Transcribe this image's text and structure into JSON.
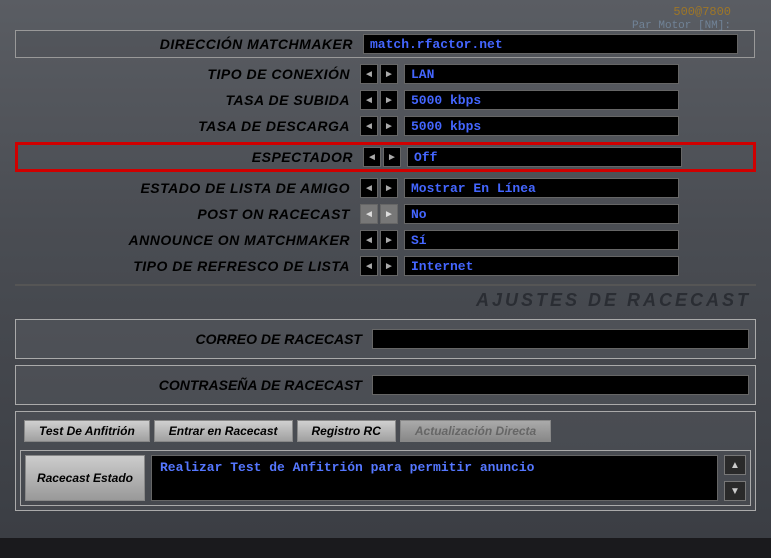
{
  "top": {
    "line1": "500@7800",
    "line2": "Par Motor [NM]:"
  },
  "settings": {
    "matchmaker": {
      "label": "DIRECCIÓN MATCHMAKER",
      "value": "match.rfactor.net"
    },
    "conn_type": {
      "label": "TIPO DE CONEXIÓN",
      "value": "LAN"
    },
    "upload": {
      "label": "TASA DE SUBIDA",
      "value": "5000 kbps"
    },
    "download": {
      "label": "TASA DE DESCARGA",
      "value": "5000 kbps"
    },
    "spectator": {
      "label": "ESPECTADOR",
      "value": "Off"
    },
    "friends": {
      "label": "ESTADO DE LISTA DE AMIGO",
      "value": "Mostrar En Línea"
    },
    "racecast_post": {
      "label": "POST ON RACECAST",
      "value": "No"
    },
    "announce": {
      "label": "ANNOUNCE ON MATCHMAKER",
      "value": "Sí"
    },
    "refresh": {
      "label": "TIPO DE REFRESCO DE LISTA",
      "value": "Internet"
    }
  },
  "section2": {
    "title": "AJUSTES DE RACECAST"
  },
  "racecast": {
    "email_label": "CORREO DE RACECAST",
    "pass_label": "CONTRASEÑA DE RACECAST",
    "email": "",
    "password": ""
  },
  "buttons": {
    "host_test": "Test De Anfitrión",
    "enter_rc": "Entrar en Racecast",
    "reg_rc": "Registro RC",
    "direct_upd": "Actualización Directa"
  },
  "status": {
    "label": "Racecast Estado",
    "text": "Realizar Test de Anfitrión para permitir anuncio"
  }
}
